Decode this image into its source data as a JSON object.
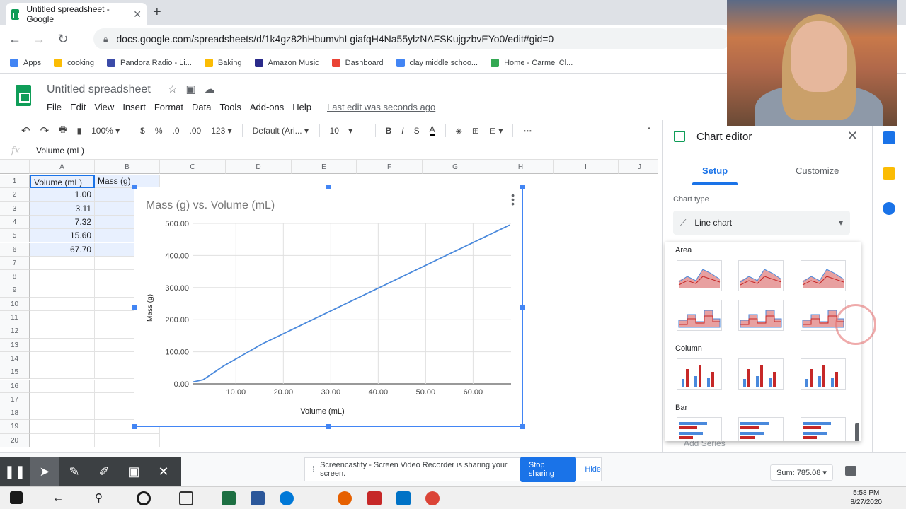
{
  "browser": {
    "tab_title": "Untitled spreadsheet - Google",
    "url": "docs.google.com/spreadsheets/d/1k4gz82hHbumvhLgiafqH4Na55ylzNAFSKujgzbvEYo0/edit#gid=0",
    "bookmarks": [
      {
        "label": "Apps",
        "color": "#4285f4"
      },
      {
        "label": "cooking",
        "color": "#fbbc04"
      },
      {
        "label": "Pandora Radio - Li...",
        "color": "#3b4ba8"
      },
      {
        "label": "Baking",
        "color": "#fbbc04"
      },
      {
        "label": "Amazon Music",
        "color": "#2a2a8a"
      },
      {
        "label": "Dashboard",
        "color": "#ea4335"
      },
      {
        "label": "clay middle schoo...",
        "color": "#4285f4"
      },
      {
        "label": "Home - Carmel Cl...",
        "color": "#34a853"
      }
    ]
  },
  "sheets": {
    "title": "Untitled spreadsheet",
    "menu": [
      "File",
      "Edit",
      "View",
      "Insert",
      "Format",
      "Data",
      "Tools",
      "Add-ons",
      "Help"
    ],
    "last_edit": "Last edit was seconds ago",
    "toolbar": {
      "zoom": "100%",
      "currency": "$",
      "percent": "%",
      "dec_less": ".0",
      "dec_more": ".00",
      "format_123": "123",
      "font": "Default (Ari...",
      "font_size": "10",
      "bold": "B",
      "italic": "I",
      "strike": "S",
      "text_color": "A"
    },
    "formula_value": "Volume (mL)",
    "columns": [
      "A",
      "B",
      "C",
      "D",
      "E",
      "F",
      "G",
      "H",
      "I",
      "J"
    ],
    "rows": [
      "1",
      "2",
      "3",
      "4",
      "5",
      "6",
      "7",
      "8",
      "9",
      "10",
      "11",
      "12",
      "13",
      "14",
      "15",
      "16",
      "17",
      "18",
      "19",
      "20"
    ],
    "cells": {
      "A1": "Volume (mL)",
      "B1": "Mass (g)",
      "A2": "1.00",
      "A3": "3.11",
      "A4": "7.32",
      "A5": "15.60",
      "A6": "67.70"
    }
  },
  "chart_data": {
    "type": "line",
    "title": "Mass (g) vs. Volume (mL)",
    "xlabel": "Volume (mL)",
    "ylabel": "Mass (g)",
    "x": [
      1.0,
      3.11,
      7.32,
      15.6,
      67.7
    ],
    "series": [
      {
        "values": [
          6.0,
          13.0,
          55.0,
          125.0,
          495.0
        ],
        "color": "#4a89dc"
      }
    ],
    "x_ticks": [
      "10.00",
      "20.00",
      "30.00",
      "40.00",
      "50.00",
      "60.00"
    ],
    "y_ticks": [
      "0.00",
      "100.00",
      "200.00",
      "300.00",
      "400.00",
      "500.00"
    ],
    "xlim": [
      1,
      68
    ],
    "ylim": [
      0,
      500
    ],
    "grid": true
  },
  "chart_editor": {
    "title": "Chart editor",
    "tab_setup": "Setup",
    "tab_customize": "Customize",
    "chart_type_label": "Chart type",
    "chart_type_value": "Line chart",
    "groups": [
      "Area",
      "Column",
      "Bar"
    ],
    "add_series": "Add Series"
  },
  "bottom": {
    "cast_text": "Screencastify - Screen Video Recorder is sharing your screen.",
    "stop_sharing": "Stop sharing",
    "hide": "Hide",
    "sum": "Sum: 785.08"
  },
  "taskbar": {
    "time": "5:58 PM",
    "date": "8/27/2020"
  }
}
